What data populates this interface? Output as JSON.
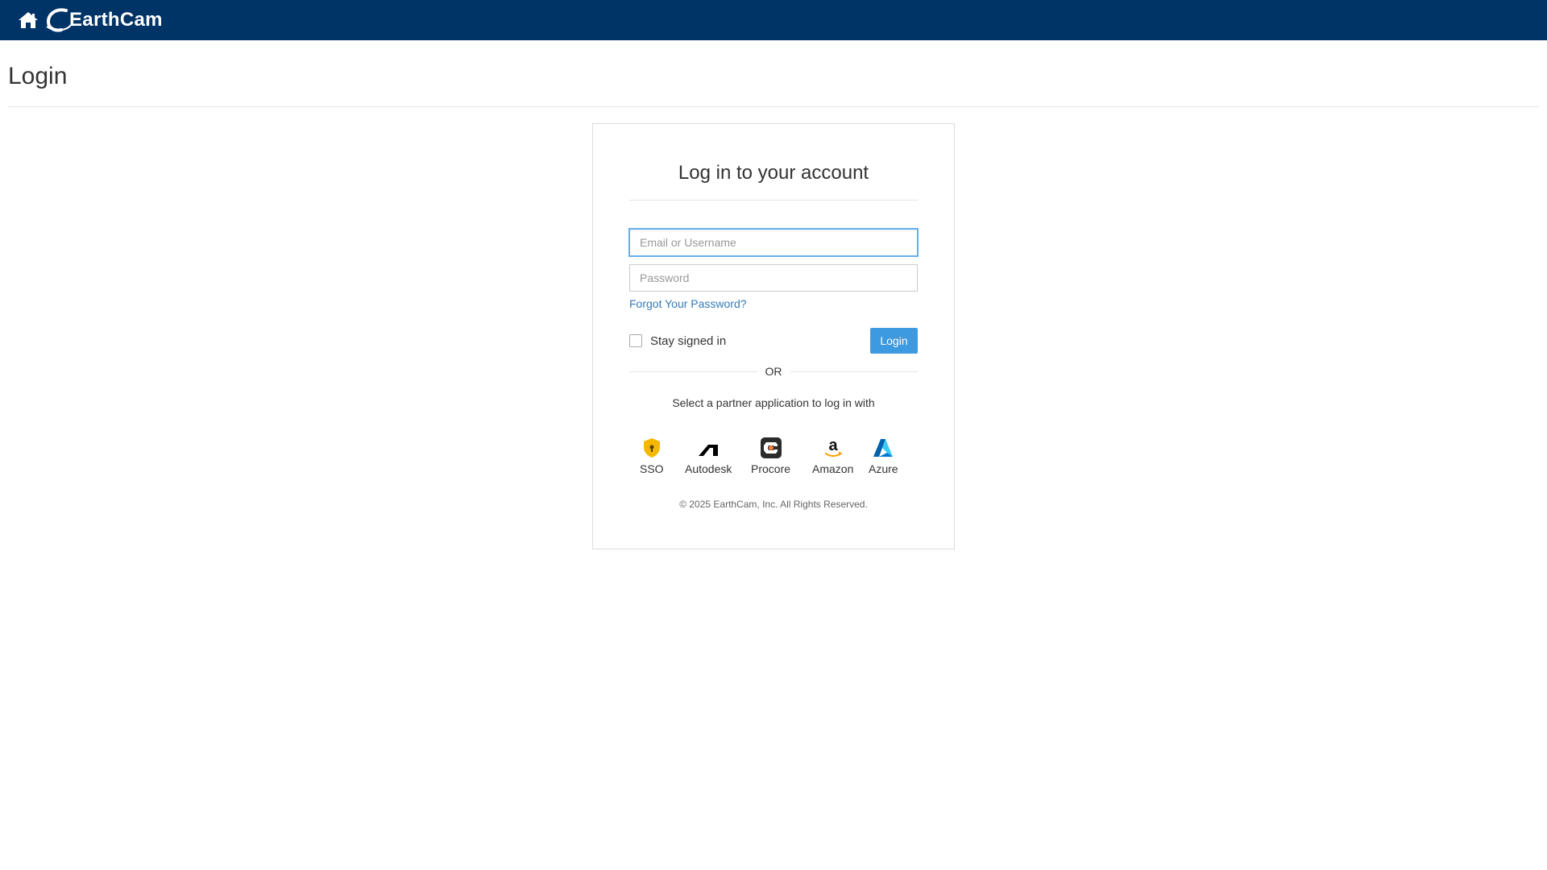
{
  "header": {
    "brand": "EarthCam",
    "brand_color": "#003366",
    "home_icon": "home-icon"
  },
  "page": {
    "title": "Login"
  },
  "login_card": {
    "title": "Log in to your account",
    "email_placeholder": "Email or Username",
    "email_value": "",
    "password_placeholder": "Password",
    "password_value": "",
    "forgot_password": "Forgot Your Password?",
    "stay_signed_in": "Stay signed in",
    "stay_signed_in_checked": false,
    "login_button": "Login",
    "or_text": "OR",
    "partner_prompt": "Select a partner application to log in with",
    "partners": [
      {
        "label": "SSO",
        "icon": "shield-lock-icon",
        "color": "#f5b800"
      },
      {
        "label": "Autodesk",
        "icon": "autodesk-icon",
        "color": "#000000"
      },
      {
        "label": "Procore",
        "icon": "procore-icon",
        "color": "#f47e42"
      },
      {
        "label": "Amazon",
        "icon": "amazon-icon",
        "color": "#ff9900"
      },
      {
        "label": "Azure",
        "icon": "azure-icon",
        "color": "#0078d4"
      }
    ],
    "copyright": "© 2025 EarthCam, Inc. All Rights Reserved."
  },
  "colors": {
    "link": "#337ab7",
    "button": "#3d9ae0",
    "focus": "#66afe9"
  }
}
